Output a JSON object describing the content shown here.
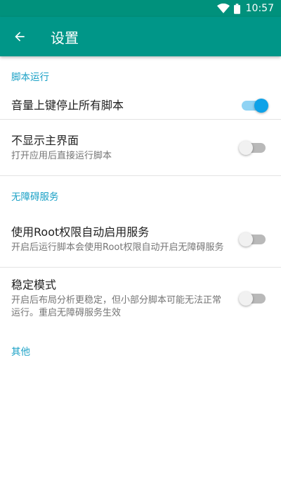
{
  "status_bar": {
    "time": "10:57",
    "wifi_icon": "wifi-icon",
    "battery_icon": "battery-icon"
  },
  "app_bar": {
    "title": "设置",
    "back_icon": "arrow-back-icon",
    "background": "#009688"
  },
  "sections": [
    {
      "title": "脚本运行",
      "items": [
        {
          "title": "音量上键停止所有脚本",
          "summary": "",
          "enabled": true
        }
      ]
    },
    {
      "title": "",
      "items": [
        {
          "title": "不显示主界面",
          "summary": "打开应用后直接运行脚本",
          "enabled": false
        }
      ]
    },
    {
      "title": "无障碍服务",
      "items": [
        {
          "title": "使用Root权限自动启用服务",
          "summary": "开启后运行脚本会使用Root权限自动开启无障碍服务",
          "enabled": false
        },
        {
          "title": "稳定模式",
          "summary": "开启后布局分析更稳定，但小部分脚本可能无法正常运行。重启无障碍服务生效",
          "enabled": false
        }
      ]
    },
    {
      "title": "其他",
      "items": []
    }
  ],
  "colors": {
    "accent": "#0ea2e8",
    "category_text": "#1ba1c6"
  }
}
